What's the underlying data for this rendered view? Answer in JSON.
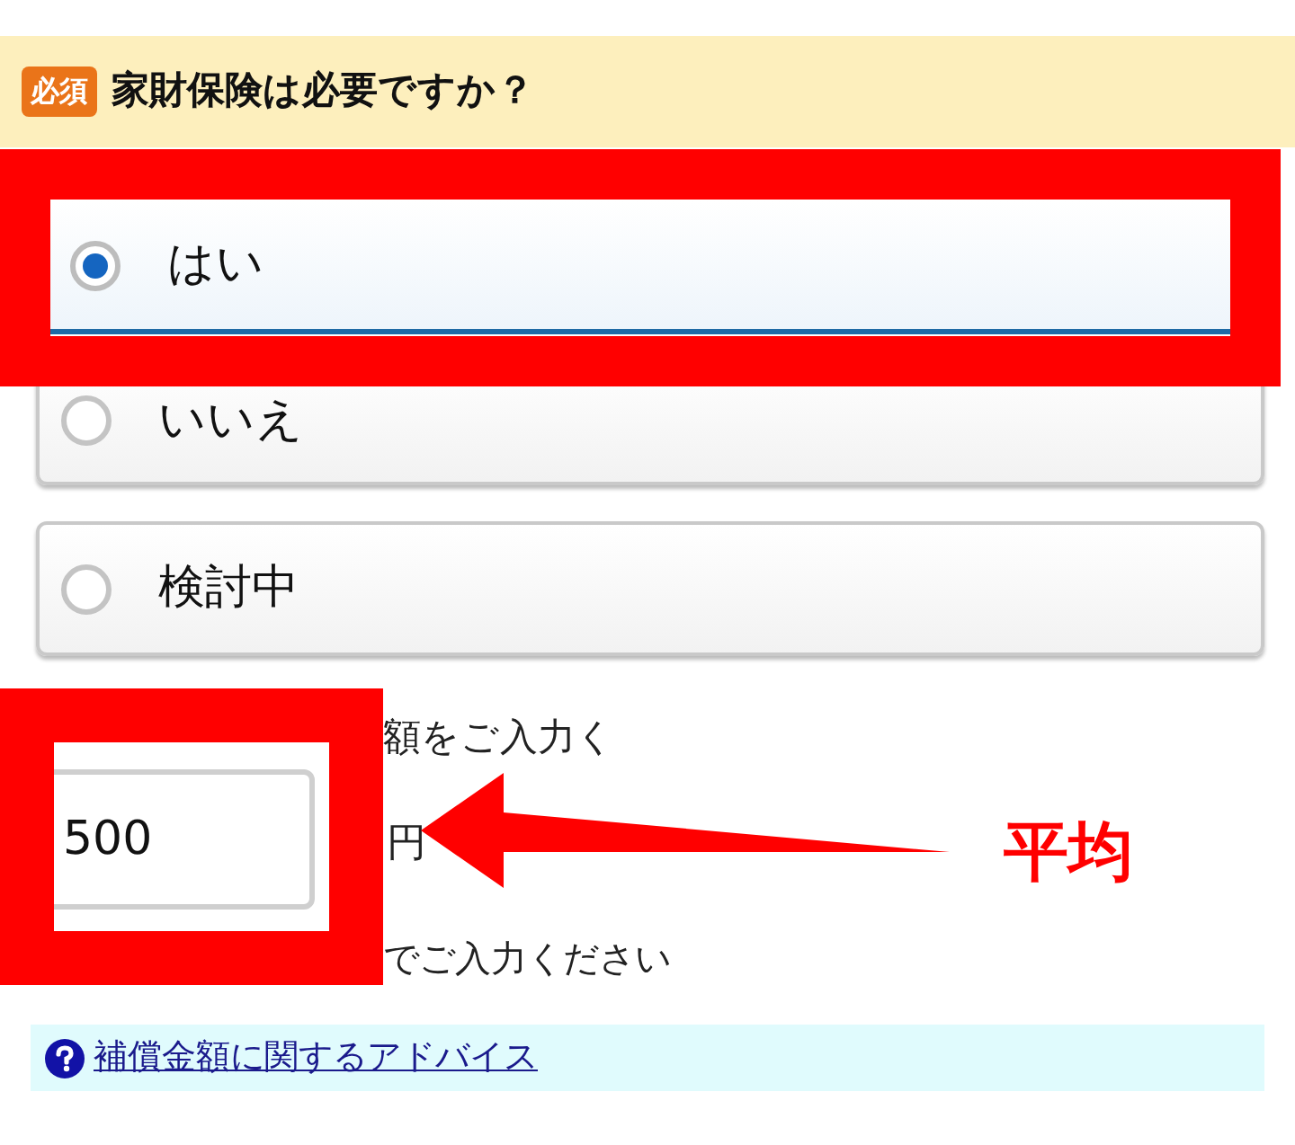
{
  "header": {
    "badge": "必須",
    "title": "家財保険は必要ですか？"
  },
  "options": [
    {
      "label": "はい",
      "selected": true
    },
    {
      "label": "いいえ",
      "selected": false
    },
    {
      "label": "検討中",
      "selected": false
    }
  ],
  "amount": {
    "prompt": "額をご入力く",
    "value": "500",
    "unit": "円",
    "note": "でご入力ください"
  },
  "advice_link": {
    "label": "補償金額に関するアドバイス"
  },
  "annotation": {
    "label": "平均"
  }
}
